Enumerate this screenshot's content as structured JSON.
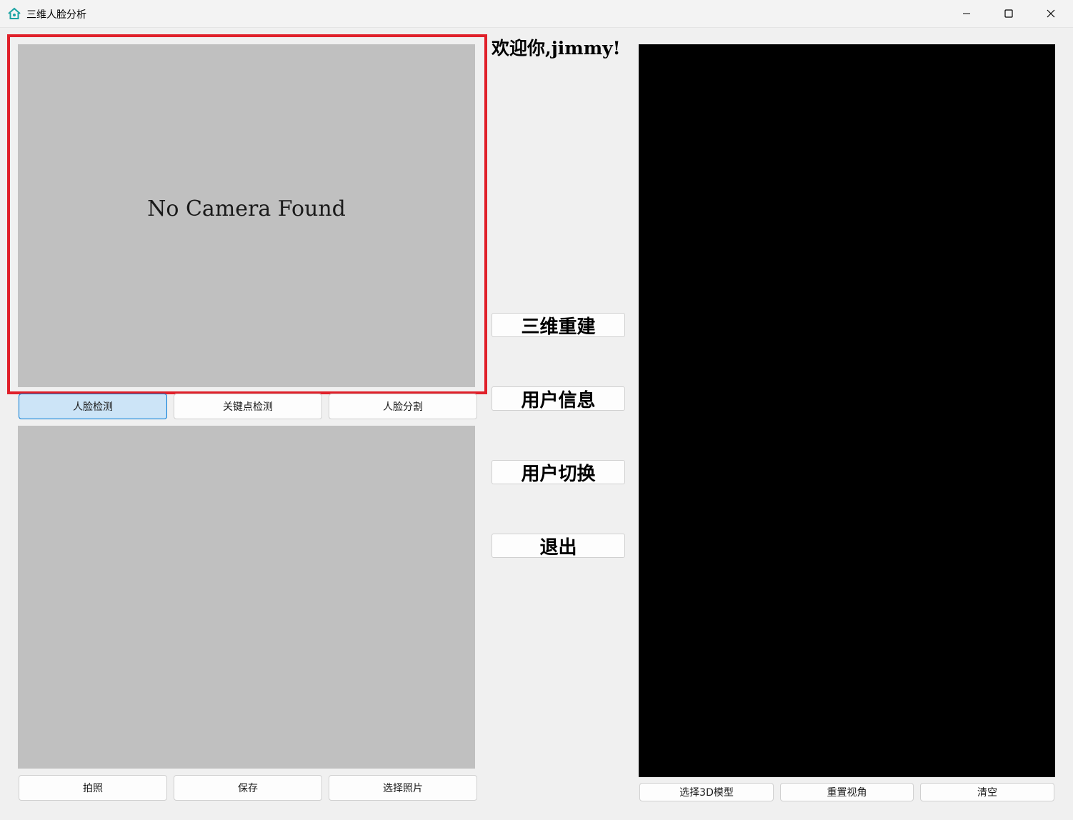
{
  "window": {
    "title": "三维人脸分析"
  },
  "camera": {
    "status_text": "No Camera Found"
  },
  "mode_buttons": [
    "人脸检测",
    "关键点检测",
    "人脸分割"
  ],
  "photo_buttons": [
    "拍照",
    "保存",
    "选择照片"
  ],
  "welcome_text": "欢迎你,jimmy!",
  "side_buttons": [
    "三维重建",
    "用户信息",
    "用户切换",
    "退出"
  ],
  "viewer_buttons": [
    "选择3D模型",
    "重置视角",
    "清空"
  ],
  "colors": {
    "highlight_border": "#e0202a",
    "active_button": "#cce4f7",
    "panel_gray": "#c0c0c0",
    "viewer_bg": "#000000"
  }
}
